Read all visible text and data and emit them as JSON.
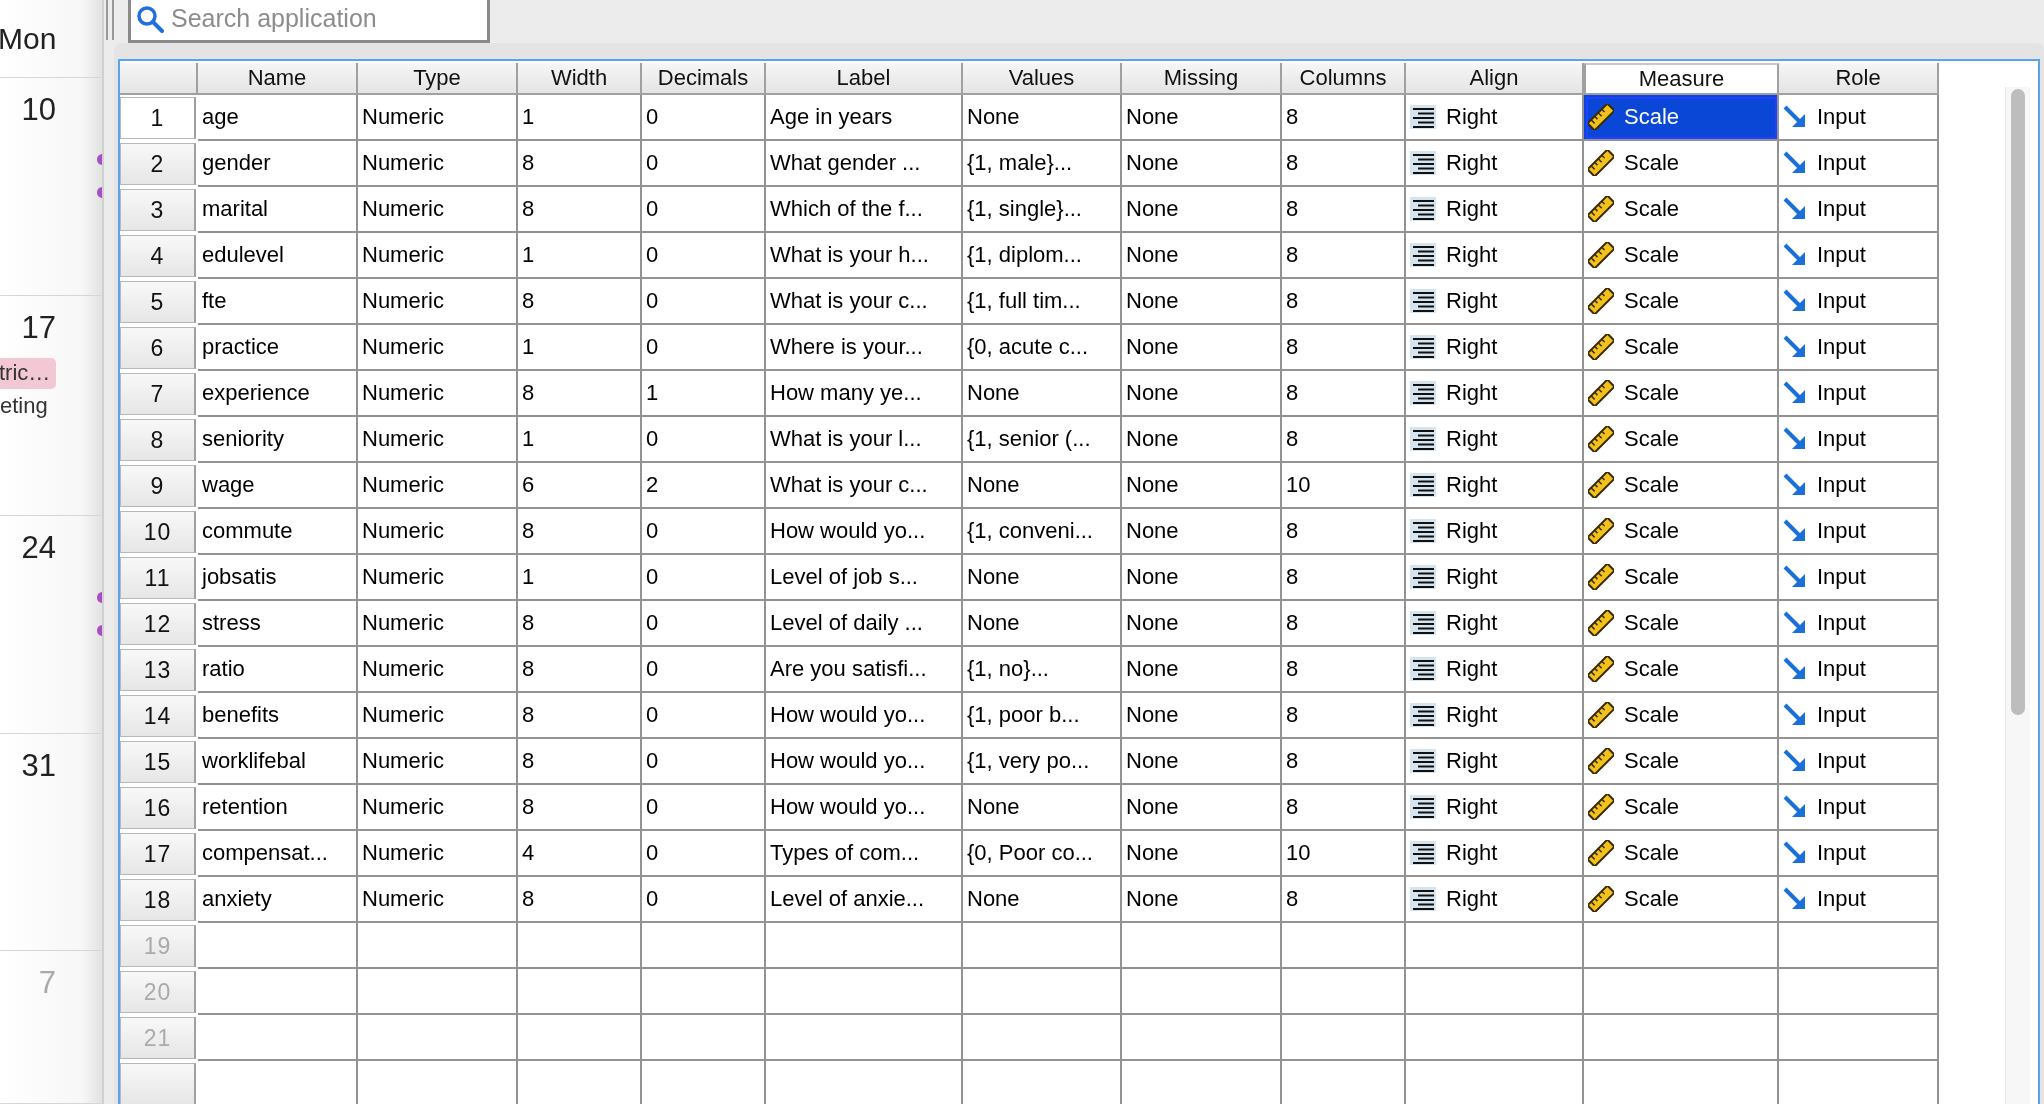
{
  "calendar": {
    "day_header": "Mon",
    "weeks": [
      {
        "date": "10",
        "muted": false,
        "dots": [
          {
            "color": "#a64fc4"
          },
          {
            "color": "#a64fc4"
          }
        ]
      },
      {
        "date": "17",
        "muted": false,
        "events": [
          {
            "kind": "badge",
            "text": "tric…",
            "color": "#f2c8d4"
          },
          {
            "kind": "plain",
            "text": "eting"
          }
        ]
      },
      {
        "date": "24",
        "muted": false,
        "dots": [
          {
            "color": "#a64fc4"
          },
          {
            "color": "#a64fc4"
          }
        ]
      },
      {
        "date": "31",
        "muted": false
      },
      {
        "date": "7",
        "muted": true
      }
    ]
  },
  "search": {
    "placeholder": "Search application"
  },
  "table": {
    "columns": [
      {
        "label": "Name",
        "kind": "text",
        "selected": false
      },
      {
        "label": "Type",
        "kind": "text",
        "selected": false
      },
      {
        "label": "Width",
        "kind": "text",
        "selected": false
      },
      {
        "label": "Decimals",
        "kind": "text",
        "selected": false
      },
      {
        "label": "Label",
        "kind": "text",
        "selected": false
      },
      {
        "label": "Values",
        "kind": "text",
        "selected": false
      },
      {
        "label": "Missing",
        "kind": "text",
        "selected": false
      },
      {
        "label": "Columns",
        "kind": "text",
        "selected": false
      },
      {
        "label": "Align",
        "kind": "align",
        "selected": false
      },
      {
        "label": "Measure",
        "kind": "measure",
        "selected": true
      },
      {
        "label": "Role",
        "kind": "role",
        "selected": false
      }
    ],
    "rows": [
      {
        "number": "1",
        "empty": false,
        "selected": true,
        "cells": [
          "age",
          "Numeric",
          "1",
          "0",
          "Age in years",
          "None",
          "None",
          "8",
          "Right",
          "Scale",
          "Input"
        ]
      },
      {
        "number": "2",
        "empty": false,
        "selected": false,
        "cells": [
          "gender",
          "Numeric",
          "8",
          "0",
          "What gender ...",
          "{1, male}...",
          "None",
          "8",
          "Right",
          "Scale",
          "Input"
        ]
      },
      {
        "number": "3",
        "empty": false,
        "selected": false,
        "cells": [
          "marital",
          "Numeric",
          "8",
          "0",
          "Which of the f...",
          "{1, single}...",
          "None",
          "8",
          "Right",
          "Scale",
          "Input"
        ]
      },
      {
        "number": "4",
        "empty": false,
        "selected": false,
        "cells": [
          "edulevel",
          "Numeric",
          "1",
          "0",
          "What is your h...",
          "{1, diplom...",
          "None",
          "8",
          "Right",
          "Scale",
          "Input"
        ]
      },
      {
        "number": "5",
        "empty": false,
        "selected": false,
        "cells": [
          "fte",
          "Numeric",
          "8",
          "0",
          "What is your c...",
          "{1, full tim...",
          "None",
          "8",
          "Right",
          "Scale",
          "Input"
        ]
      },
      {
        "number": "6",
        "empty": false,
        "selected": false,
        "cells": [
          "practice",
          "Numeric",
          "1",
          "0",
          "Where is your...",
          "{0, acute c...",
          "None",
          "8",
          "Right",
          "Scale",
          "Input"
        ]
      },
      {
        "number": "7",
        "empty": false,
        "selected": false,
        "cells": [
          "experience",
          "Numeric",
          "8",
          "1",
          "How many ye...",
          "None",
          "None",
          "8",
          "Right",
          "Scale",
          "Input"
        ]
      },
      {
        "number": "8",
        "empty": false,
        "selected": false,
        "cells": [
          "seniority",
          "Numeric",
          "1",
          "0",
          "What is your l...",
          "{1, senior (...",
          "None",
          "8",
          "Right",
          "Scale",
          "Input"
        ]
      },
      {
        "number": "9",
        "empty": false,
        "selected": false,
        "cells": [
          "wage",
          "Numeric",
          "6",
          "2",
          "What is your c...",
          "None",
          "None",
          "10",
          "Right",
          "Scale",
          "Input"
        ]
      },
      {
        "number": "10",
        "empty": false,
        "selected": false,
        "cells": [
          "commute",
          "Numeric",
          "8",
          "0",
          "How would yo...",
          "{1, conveni...",
          "None",
          "8",
          "Right",
          "Scale",
          "Input"
        ]
      },
      {
        "number": "11",
        "empty": false,
        "selected": false,
        "cells": [
          "jobsatis",
          "Numeric",
          "1",
          "0",
          "Level of job s...",
          "None",
          "None",
          "8",
          "Right",
          "Scale",
          "Input"
        ]
      },
      {
        "number": "12",
        "empty": false,
        "selected": false,
        "cells": [
          "stress",
          "Numeric",
          "8",
          "0",
          "Level of daily ...",
          "None",
          "None",
          "8",
          "Right",
          "Scale",
          "Input"
        ]
      },
      {
        "number": "13",
        "empty": false,
        "selected": false,
        "cells": [
          "ratio",
          "Numeric",
          "8",
          "0",
          "Are you satisfi...",
          "{1, no}...",
          "None",
          "8",
          "Right",
          "Scale",
          "Input"
        ]
      },
      {
        "number": "14",
        "empty": false,
        "selected": false,
        "cells": [
          "benefits",
          "Numeric",
          "8",
          "0",
          "How would yo...",
          "{1, poor b...",
          "None",
          "8",
          "Right",
          "Scale",
          "Input"
        ]
      },
      {
        "number": "15",
        "empty": false,
        "selected": false,
        "cells": [
          "worklifebal",
          "Numeric",
          "8",
          "0",
          "How would yo...",
          "{1, very po...",
          "None",
          "8",
          "Right",
          "Scale",
          "Input"
        ]
      },
      {
        "number": "16",
        "empty": false,
        "selected": false,
        "cells": [
          "retention",
          "Numeric",
          "8",
          "0",
          "How would yo...",
          "None",
          "None",
          "8",
          "Right",
          "Scale",
          "Input"
        ]
      },
      {
        "number": "17",
        "empty": false,
        "selected": false,
        "cells": [
          "compensat...",
          "Numeric",
          "4",
          "0",
          "Types of com...",
          "{0, Poor co...",
          "None",
          "10",
          "Right",
          "Scale",
          "Input"
        ]
      },
      {
        "number": "18",
        "empty": false,
        "selected": false,
        "cells": [
          "anxiety",
          "Numeric",
          "8",
          "0",
          "Level of anxie...",
          "None",
          "None",
          "8",
          "Right",
          "Scale",
          "Input"
        ]
      },
      {
        "number": "19",
        "empty": true,
        "selected": false
      },
      {
        "number": "20",
        "empty": true,
        "selected": false
      },
      {
        "number": "21",
        "empty": true,
        "selected": false
      }
    ]
  }
}
